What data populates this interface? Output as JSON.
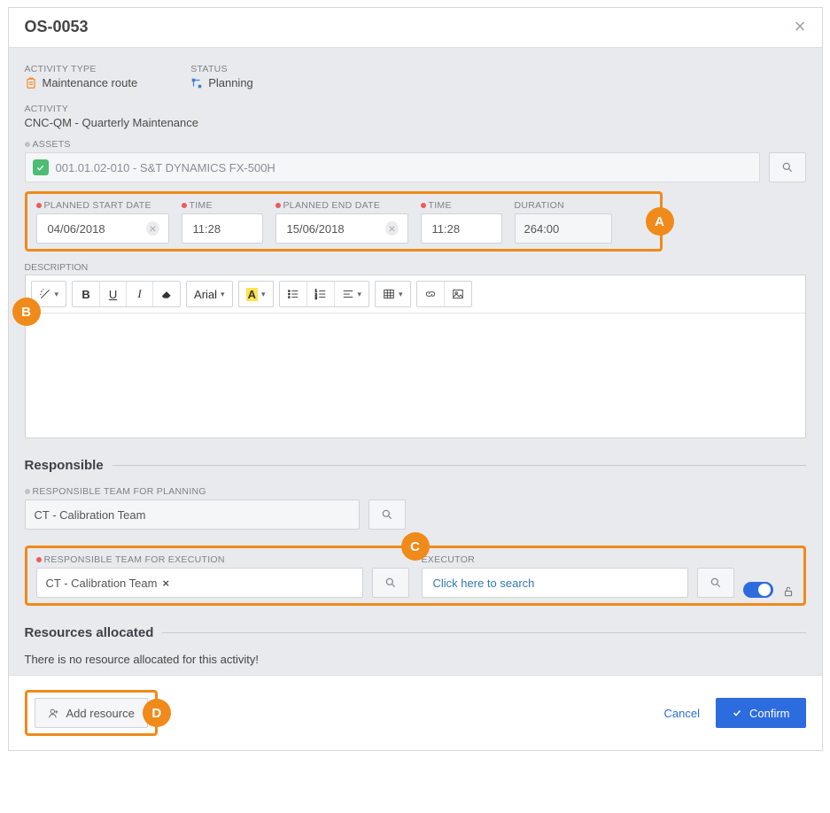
{
  "header": {
    "title": "OS-0053"
  },
  "info": {
    "activity_type_label": "ACTIVITY TYPE",
    "activity_type_value": "Maintenance route",
    "status_label": "STATUS",
    "status_value": "Planning",
    "activity_label": "ACTIVITY",
    "activity_value": "CNC-QM - Quarterly Maintenance"
  },
  "assets": {
    "label": "ASSETS",
    "value": "001.01.02-010 - S&T DYNAMICS FX-500H"
  },
  "dates": {
    "planned_start_label": "PLANNED START DATE",
    "planned_start_value": "04/06/2018",
    "start_time_label": "TIME",
    "start_time_value": "11:28",
    "planned_end_label": "PLANNED END DATE",
    "planned_end_value": "15/06/2018",
    "end_time_label": "TIME",
    "end_time_value": "11:28",
    "duration_label": "DURATION",
    "duration_value": "264:00"
  },
  "description": {
    "label": "DESCRIPTION"
  },
  "toolbar": {
    "font": "Arial"
  },
  "sections": {
    "responsible": "Responsible",
    "resources": "Resources allocated"
  },
  "responsible": {
    "planning_label": "RESPONSIBLE TEAM FOR PLANNING",
    "planning_value": "CT - Calibration Team",
    "execution_label": "RESPONSIBLE TEAM FOR EXECUTION",
    "execution_chip": "CT - Calibration Team",
    "executor_label": "EXECUTOR",
    "executor_placeholder": "Click here to search"
  },
  "resources": {
    "empty_msg": "There is no resource allocated for this activity!",
    "add_btn": "Add resource"
  },
  "footer": {
    "cancel": "Cancel",
    "confirm": "Confirm"
  },
  "callouts": {
    "A": "A",
    "B": "B",
    "C": "C",
    "D": "D"
  }
}
